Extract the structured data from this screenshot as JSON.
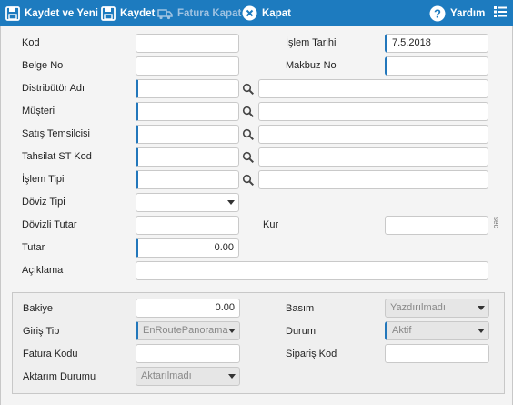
{
  "toolbar": {
    "save_new": "Kaydet ve Yeni",
    "save": "Kaydet",
    "invoice_close": "Fatura Kapat",
    "close": "Kapat",
    "help": "Yardım"
  },
  "form": {
    "kod": {
      "label": "Kod",
      "value": ""
    },
    "islem_tarihi": {
      "label": "İşlem Tarihi",
      "value": "7.5.2018"
    },
    "belge_no": {
      "label": "Belge No",
      "value": ""
    },
    "makbuz_no": {
      "label": "Makbuz No",
      "value": ""
    },
    "distributor_adi": {
      "label": "Distribütör Adı",
      "value": ""
    },
    "musteri": {
      "label": "Müşteri",
      "value": ""
    },
    "satis_temsilcisi": {
      "label": "Satış Temsilcisi",
      "value": ""
    },
    "tahsilat_st_kod": {
      "label": "Tahsilat ST Kod",
      "value": ""
    },
    "islem_tipi": {
      "label": "İşlem Tipi",
      "value": ""
    },
    "doviz_tipi": {
      "label": "Döviz Tipi",
      "value": ""
    },
    "dovizli_tutar": {
      "label": "Dövizli Tutar",
      "value": ""
    },
    "kur": {
      "label": "Kur",
      "value": "",
      "side_text": "sec"
    },
    "tutar": {
      "label": "Tutar",
      "value": "0.00"
    },
    "aciklama": {
      "label": "Açıklama",
      "value": ""
    }
  },
  "panel": {
    "bakiye": {
      "label": "Bakiye",
      "value": "0.00"
    },
    "basim": {
      "label": "Basım",
      "value": "Yazdırılmadı"
    },
    "giris_tip": {
      "label": "Giriş Tip",
      "value": "EnRoutePanorama"
    },
    "durum": {
      "label": "Durum",
      "value": "Aktif"
    },
    "fatura_kodu": {
      "label": "Fatura Kodu",
      "value": ""
    },
    "siparis_kod": {
      "label": "Sipariş Kod",
      "value": ""
    },
    "aktarim_durumu": {
      "label": "Aktarım Durumu",
      "value": "Aktarılmadı"
    }
  },
  "icons": {
    "save_new": "floppy-icon",
    "save": "floppy-icon",
    "invoice_close": "truck-icon",
    "close": "close-circle-icon",
    "help": "question-circle-icon",
    "menu": "list-menu-icon",
    "search": "magnifier-icon"
  },
  "colors": {
    "toolbar_bg": "#1d7bbf",
    "required_marker": "#2277bb"
  }
}
